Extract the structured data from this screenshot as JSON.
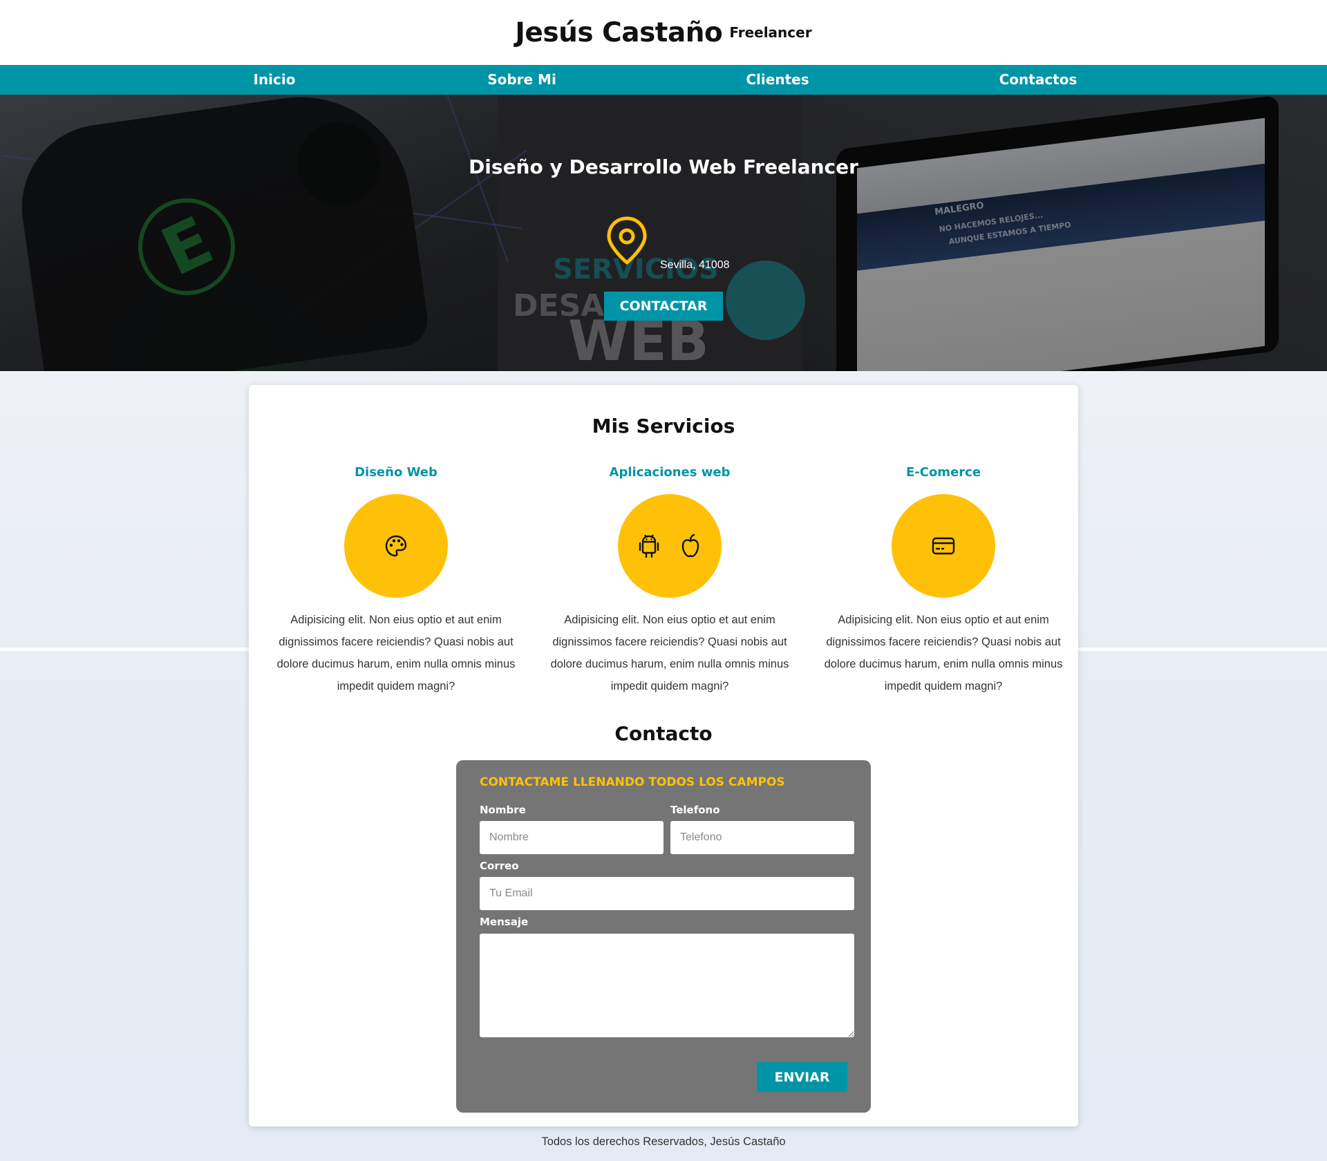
{
  "header": {
    "name": "Jesús Castaño",
    "subtitle": "Freelancer"
  },
  "nav": {
    "items": [
      {
        "label": "Inicio"
      },
      {
        "label": "Sobre Mi"
      },
      {
        "label": "Clientes"
      },
      {
        "label": "Contactos"
      }
    ]
  },
  "hero": {
    "title": "Diseño y Desarrollo Web Freelancer",
    "location": "Sevilla, 41008",
    "button_label": "CONTACTAR",
    "location_icon": "map-pin-icon",
    "background_words": {
      "servicios": "SERVICIOS",
      "desarrollo": "DESAR",
      "web": "WEB",
      "brand": "MALEGRO",
      "slogan_1": "NO HACEMOS RELOJES...",
      "slogan_2": "AUNQUE ESTAMOS A TIEMPO"
    }
  },
  "services": {
    "title": "Mis Servicios",
    "items": [
      {
        "title": "Diseño Web",
        "icons": [
          "palette-icon"
        ],
        "text": "Adipisicing elit. Non eius optio et aut enim dignissimos facere reiciendis? Quasi nobis aut dolore ducimus harum, enim nulla omnis minus impedit quidem magni?"
      },
      {
        "title": "Aplicaciones web",
        "icons": [
          "android-icon",
          "apple-icon"
        ],
        "text": "Adipisicing elit. Non eius optio et aut enim dignissimos facere reiciendis? Quasi nobis aut dolore ducimus harum, enim nulla omnis minus impedit quidem magni?"
      },
      {
        "title": "E-Comerce",
        "icons": [
          "credit-card-icon"
        ],
        "text": "Adipisicing elit. Non eius optio et aut enim dignissimos facere reiciendis? Quasi nobis aut dolore ducimus harum, enim nulla omnis minus impedit quidem magni?"
      }
    ]
  },
  "contact": {
    "title": "Contacto",
    "heading": "CONTACTAME LLENANDO TODOS LOS CAMPOS",
    "fields": {
      "name": {
        "label": "Nombre",
        "placeholder": "Nombre",
        "value": ""
      },
      "phone": {
        "label": "Telefono",
        "placeholder": "Telefono",
        "value": ""
      },
      "email": {
        "label": "Correo",
        "placeholder": "Tu Email",
        "value": ""
      },
      "message": {
        "label": "Mensaje",
        "placeholder": "",
        "value": ""
      }
    },
    "submit_label": "ENVIAR"
  },
  "footer": {
    "text": "Todos los derechos Reservados, Jesús Castaño"
  },
  "colors": {
    "primary": "#0094a7",
    "accent": "#ffc107",
    "form_bg": "#757575",
    "header_bg": "#ffffff"
  }
}
